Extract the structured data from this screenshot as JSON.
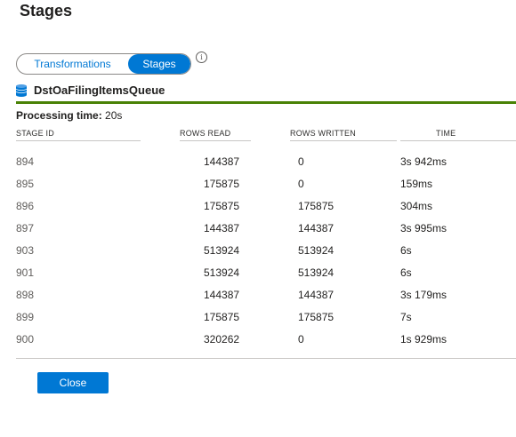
{
  "dialog": {
    "title": "Stages"
  },
  "toggle": {
    "left_label": "Transformations",
    "right_label": "Stages"
  },
  "queue": {
    "name": "DstOaFilingItemsQueue"
  },
  "processing": {
    "label": "Processing time:",
    "value": "20s"
  },
  "table": {
    "headers": {
      "stage_id": "STAGE ID",
      "rows_read": "ROWS READ",
      "rows_written": "ROWS WRITTEN",
      "time": "TIME"
    },
    "rows": [
      {
        "stage_id": "894",
        "rows_read": "144387",
        "rows_written": "0",
        "time": "3s 942ms"
      },
      {
        "stage_id": "895",
        "rows_read": "175875",
        "rows_written": "0",
        "time": "159ms"
      },
      {
        "stage_id": "896",
        "rows_read": "175875",
        "rows_written": "175875",
        "time": "304ms"
      },
      {
        "stage_id": "897",
        "rows_read": "144387",
        "rows_written": "144387",
        "time": "3s 995ms"
      },
      {
        "stage_id": "903",
        "rows_read": "513924",
        "rows_written": "513924",
        "time": "6s"
      },
      {
        "stage_id": "901",
        "rows_read": "513924",
        "rows_written": "513924",
        "time": "6s"
      },
      {
        "stage_id": "898",
        "rows_read": "144387",
        "rows_written": "144387",
        "time": "3s 179ms"
      },
      {
        "stage_id": "899",
        "rows_read": "175875",
        "rows_written": "175875",
        "time": "7s"
      },
      {
        "stage_id": "900",
        "rows_read": "320262",
        "rows_written": "0",
        "time": "1s 929ms"
      }
    ]
  },
  "footer": {
    "close_label": "Close"
  },
  "colors": {
    "accent": "#0078d4",
    "queue_underline": "#498205"
  }
}
